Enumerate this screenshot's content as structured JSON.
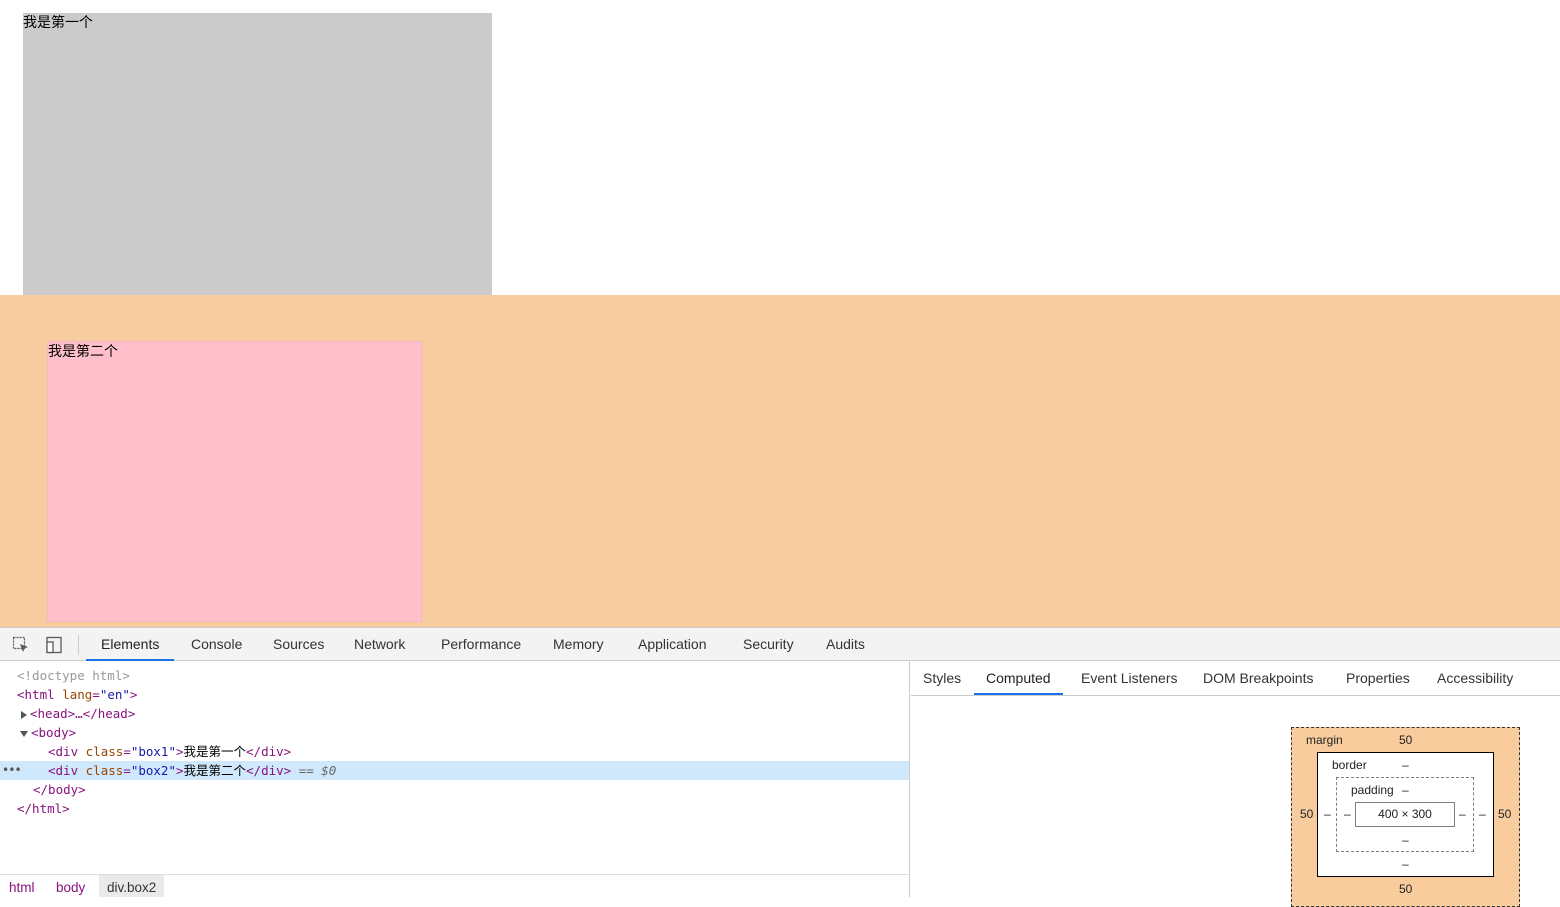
{
  "page": {
    "box1_text": "我是第一个",
    "box2_text": "我是第二个"
  },
  "devtools": {
    "tabs": [
      "Elements",
      "Console",
      "Sources",
      "Network",
      "Performance",
      "Memory",
      "Application",
      "Security",
      "Audits"
    ],
    "active_tab": "Elements",
    "icons": [
      "inspect-element-icon",
      "device-toolbar-icon"
    ],
    "dom": {
      "doctype": "<!doctype html>",
      "html_open_tag": "html",
      "html_attr_name": "lang",
      "html_attr_value": "\"en\"",
      "head_collapsed": "<head>…</head>",
      "body_open": "<body>",
      "div1_attr_value": "\"box1\"",
      "div1_text": "我是第一个",
      "div2_attr_value": "\"box2\"",
      "div2_text": "我是第二个",
      "selected_marker": "== $0",
      "body_close": "</body>",
      "html_close": "</html>"
    },
    "breadcrumbs": [
      "html",
      "body",
      "div.box2"
    ],
    "side_tabs": [
      "Styles",
      "Computed",
      "Event Listeners",
      "DOM Breakpoints",
      "Properties",
      "Accessibility"
    ],
    "active_side_tab": "Computed",
    "box_model": {
      "margin_label": "margin",
      "margin_top": "50",
      "margin_bottom": "50",
      "margin_left": "50",
      "margin_right": "50",
      "border_label": "border",
      "border_top": "–",
      "border_bottom": "–",
      "border_left": "–",
      "border_right": "–",
      "padding_label": "padding",
      "padding_top": "–",
      "padding_bottom": "–",
      "padding_left": "–",
      "padding_right": "–",
      "content": "400 × 300",
      "margin_color": "#f9cc9d"
    }
  }
}
